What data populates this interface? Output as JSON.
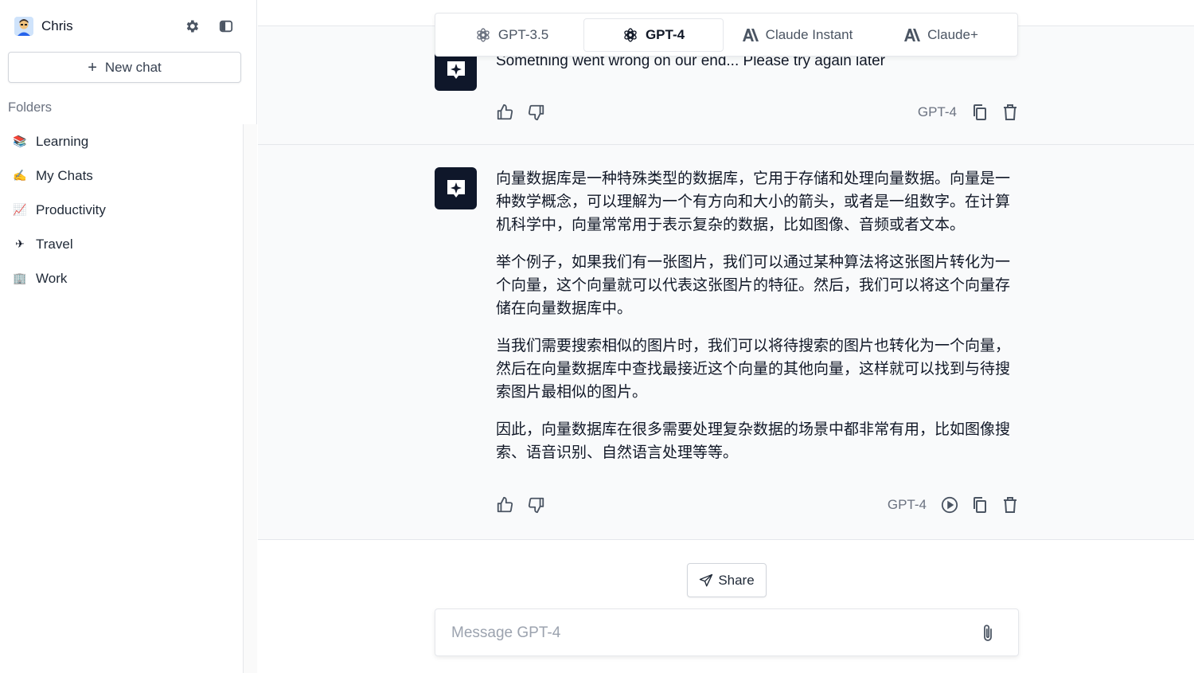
{
  "sidebar": {
    "user": {
      "name": "Chris",
      "avatar_icon": "user-avatar-icon"
    },
    "settings_icon": "gear-icon",
    "toggle_icon": "sidebar-toggle-icon",
    "new_chat_label": "New chat",
    "folders_label": "Folders",
    "folders": [
      {
        "emoji": "📚",
        "label": "Learning"
      },
      {
        "emoji": "✍️",
        "label": "My Chats"
      },
      {
        "emoji": "📈",
        "label": "Productivity"
      },
      {
        "emoji": "✈",
        "label": "Travel"
      },
      {
        "emoji": "🏢",
        "label": "Work"
      }
    ]
  },
  "model_tabs": [
    {
      "label": "GPT-3.5",
      "icon": "openai-icon",
      "active": false
    },
    {
      "label": "GPT-4",
      "icon": "openai-icon",
      "active": true
    },
    {
      "label": "Claude Instant",
      "icon": "anthropic-icon",
      "active": false
    },
    {
      "label": "Claude+",
      "icon": "anthropic-icon",
      "active": false
    }
  ],
  "messages": [
    {
      "model": "GPT-4",
      "paragraphs": [
        "Something went wrong on our end... Please try again later"
      ]
    },
    {
      "model": "GPT-4",
      "paragraphs": [
        "向量数据库是一种特殊类型的数据库，它用于存储和处理向量数据。向量是一种数学概念，可以理解为一个有方向和大小的箭头，或者是一组数字。在计算机科学中，向量常常用于表示复杂的数据，比如图像、音频或者文本。",
        "举个例子，如果我们有一张图片，我们可以通过某种算法将这张图片转化为一个向量，这个向量就可以代表这张图片的特征。然后，我们可以将这个向量存储在向量数据库中。",
        "当我们需要搜索相似的图片时，我们可以将待搜索的图片也转化为一个向量，然后在向量数据库中查找最接近这个向量的其他向量，这样就可以找到与待搜索图片最相似的图片。",
        "因此，向量数据库在很多需要处理复杂数据的场景中都非常有用，比如图像搜索、语音识别、自然语言处理等等。"
      ]
    }
  ],
  "share_label": "Share",
  "input": {
    "placeholder": "Message GPT-4",
    "value": ""
  },
  "colors": {
    "bot_avatar_bg": "#0f172a",
    "message_bg": "#f9fafb",
    "border": "#e5e7eb"
  }
}
